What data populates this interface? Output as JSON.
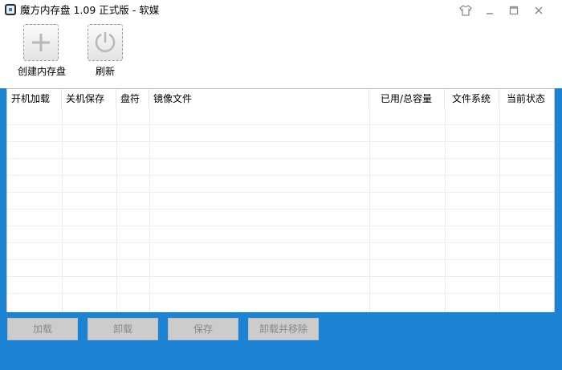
{
  "window": {
    "title": "魔方内存盘 1.09 正式版 - 软媒"
  },
  "titlebar_controls": {
    "skin_icon": "shirt-icon",
    "minimize_icon": "minimize-icon",
    "maximize_icon": "maximize-icon",
    "close_icon": "close-icon"
  },
  "toolbar": {
    "create_label": "创建内存盘",
    "create_icon": "plus-icon",
    "refresh_label": "刷新",
    "refresh_icon": "refresh-icon"
  },
  "table": {
    "columns": [
      "开机加载",
      "关机保存",
      "盘符",
      "镜像文件",
      "已用/总容量",
      "文件系统",
      "当前状态"
    ],
    "rows": []
  },
  "actions": {
    "load_label": "加载",
    "unload_label": "卸载",
    "save_label": "保存",
    "unload_remove_label": "卸载并移除"
  },
  "colors": {
    "background": "#1b82d4",
    "disabled_button": "#cccccc",
    "disabled_text": "#8a8a8a"
  }
}
